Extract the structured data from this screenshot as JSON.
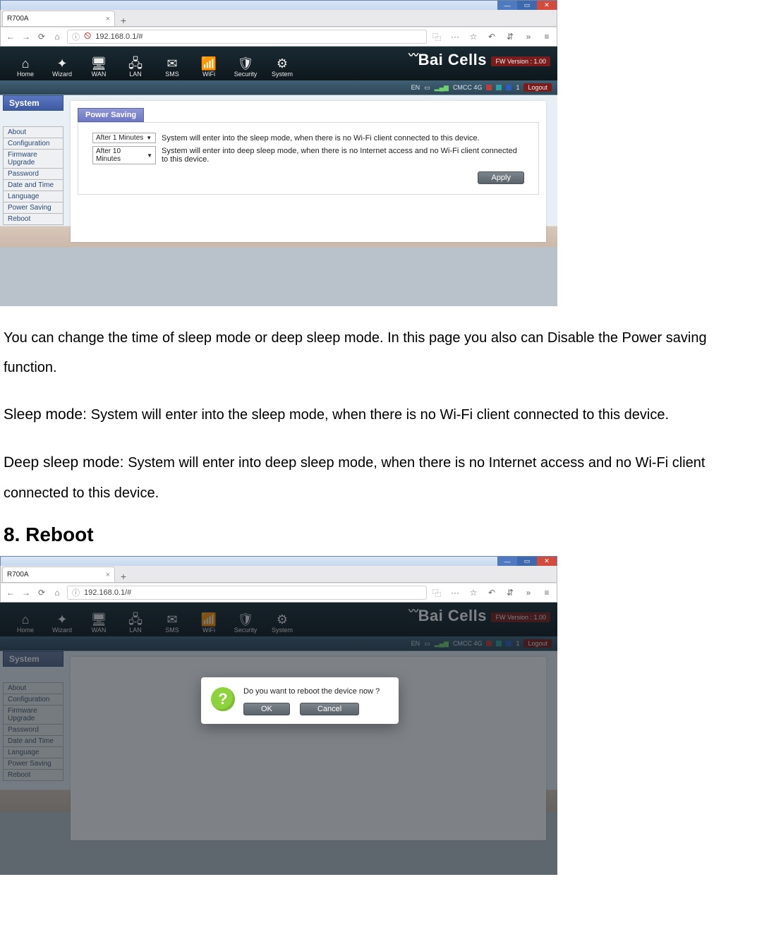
{
  "browser": {
    "tab_title": "R700A",
    "new_tab_label": "+",
    "tab_close": "×",
    "url": "192.168.0.1/#",
    "url_info_icon": "ⓘ",
    "url_blocked_icon": "blocked-icon",
    "nav_back": "←",
    "nav_fwd": "→",
    "nav_reload": "⟳",
    "nav_home": "⌂",
    "toolbar_qr": "⿻",
    "toolbar_more": "···",
    "toolbar_star": "☆",
    "toolbar_undo": "↶",
    "toolbar_ext": "⇵",
    "toolbar_over": "»",
    "toolbar_menu": "≡",
    "win_min": "—",
    "win_max": "▭",
    "win_close": "✕"
  },
  "router": {
    "brand": "Bai Cells",
    "fw_version": "FW Version : 1.00",
    "menu": {
      "home": "Home",
      "wizard": "Wizard",
      "wan": "WAN",
      "lan": "LAN",
      "sms": "SMS",
      "wifi": "WiFi",
      "security": "Security",
      "system": "System"
    },
    "icons": {
      "home": "⌂",
      "wizard": "✦",
      "wan": "🖥",
      "lan": "🖧",
      "sms": "✉",
      "wifi": "📶",
      "security": "🛡",
      "system": "⚙"
    },
    "status": {
      "lang": "EN",
      "sim": "▭",
      "signal_icon": "▂▄▆",
      "carrier": "CMCC  4G",
      "count": "1",
      "logout": "Logout"
    },
    "section_title": "System",
    "sidebar": [
      "About",
      "Configuration",
      "Firmware Upgrade",
      "Password",
      "Date and Time",
      "Language",
      "Power Saving",
      "Reboot"
    ]
  },
  "power_saving": {
    "tab_label": "Power Saving",
    "sleep_select": "After 1 Minutes",
    "sleep_desc": "System will enter into the sleep mode, when there is no Wi-Fi client connected to this device.",
    "deep_select": "After 10 Minutes",
    "deep_desc": "System will enter into deep sleep mode, when there is no Internet access and no Wi-Fi client connected to this device.",
    "apply": "Apply"
  },
  "doc": {
    "p1": "You can change the time of sleep mode or deep sleep mode. In this page you also can Disable the Power saving function.",
    "sleep_label": "Sleep mode: ",
    "sleep_text": "System will enter into the sleep mode, when there is no Wi-Fi client connected to this device.",
    "deep_label": "Deep sleep mode: ",
    "deep_text": "System will enter into deep sleep mode, when there is no Internet access and no Wi-Fi client connected to this device.",
    "h_reboot": "8. Reboot"
  },
  "reboot_modal": {
    "message": "Do you want to reboot the device now ?",
    "ok": "OK",
    "cancel": "Cancel"
  }
}
